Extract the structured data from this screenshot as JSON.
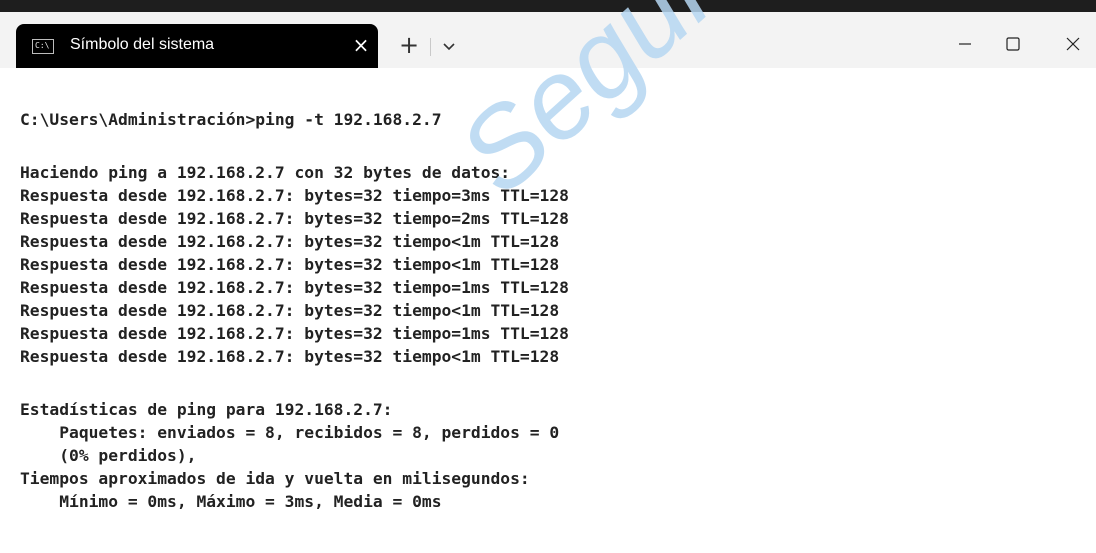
{
  "window": {
    "tab_title": "Símbolo del sistema",
    "tab_icon_text": "C:\\",
    "close_tab": "×",
    "new_tab": "+",
    "colors": {
      "tab_bg": "#000000",
      "titlebar_bg": "#f3f3f3",
      "console_bg": "#ffffff",
      "text": "#222222",
      "watermark": "#b6d7f2"
    }
  },
  "console": {
    "lines": [
      "C:\\Users\\Administración>ping -t 192.168.2.7",
      "",
      "Haciendo ping a 192.168.2.7 con 32 bytes de datos:",
      "Respuesta desde 192.168.2.7: bytes=32 tiempo=3ms TTL=128",
      "Respuesta desde 192.168.2.7: bytes=32 tiempo=2ms TTL=128",
      "Respuesta desde 192.168.2.7: bytes=32 tiempo<1m TTL=128",
      "Respuesta desde 192.168.2.7: bytes=32 tiempo<1m TTL=128",
      "Respuesta desde 192.168.2.7: bytes=32 tiempo=1ms TTL=128",
      "Respuesta desde 192.168.2.7: bytes=32 tiempo<1m TTL=128",
      "Respuesta desde 192.168.2.7: bytes=32 tiempo=1ms TTL=128",
      "Respuesta desde 192.168.2.7: bytes=32 tiempo<1m TTL=128",
      "",
      "Estadísticas de ping para 192.168.2.7:",
      "    Paquetes: enviados = 8, recibidos = 8, perdidos = 0",
      "    (0% perdidos),",
      "Tiempos aproximados de ida y vuelta en milisegundos:",
      "    Mínimo = 0ms, Máximo = 3ms, Media = 0ms"
    ]
  },
  "watermark": "Seguridad"
}
